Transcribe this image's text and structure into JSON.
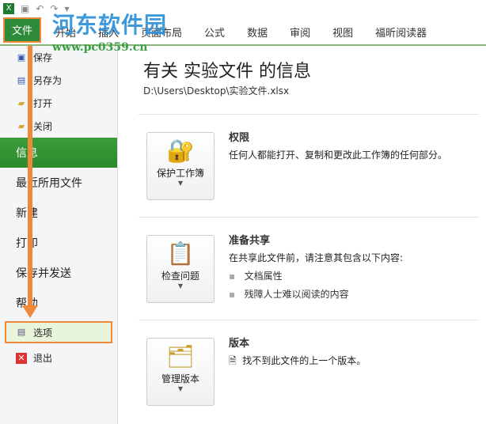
{
  "qat": {
    "app_icon": "X"
  },
  "ribbon": {
    "file_tab": "文件",
    "tabs": [
      "开始",
      "插入",
      "页面布局",
      "公式",
      "数据",
      "审阅",
      "视图",
      "福昕阅读器"
    ]
  },
  "watermark": {
    "title": "河东软件园",
    "url": "www.pc0359.cn"
  },
  "sidebar": {
    "small_items": [
      {
        "label": "保存",
        "icon": "save-icon"
      },
      {
        "label": "另存为",
        "icon": "save-as-icon"
      },
      {
        "label": "打开",
        "icon": "open-folder-icon"
      },
      {
        "label": "关闭",
        "icon": "close-folder-icon"
      }
    ],
    "big_items": [
      "信息",
      "最近所用文件",
      "新建",
      "打印",
      "保存并发送",
      "帮助"
    ],
    "options": "选项",
    "exit": "退出"
  },
  "main": {
    "title": "有关 实验文件 的信息",
    "path": "D:\\Users\\Desktop\\实验文件.xlsx",
    "sections": [
      {
        "button": "保护工作簿",
        "title": "权限",
        "desc": "任何人都能打开、复制和更改此工作簿的任何部分。",
        "items": []
      },
      {
        "button": "检查问题",
        "title": "准备共享",
        "desc": "在共享此文件前，请注意其包含以下内容:",
        "items": [
          "文档属性",
          "残障人士难以阅读的内容"
        ]
      },
      {
        "button": "管理版本",
        "title": "版本",
        "desc": "找不到此文件的上一个版本。",
        "items": []
      }
    ]
  },
  "colors": {
    "accent": "#2e8b3a",
    "highlight": "#f0883a"
  }
}
